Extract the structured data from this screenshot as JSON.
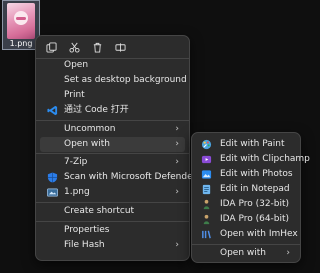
{
  "file": {
    "name": "1.png"
  },
  "quick_actions": [
    "copy-icon",
    "cut-icon",
    "delete-icon",
    "rename-icon"
  ],
  "menu": {
    "open": "Open",
    "set_desktop_bg": "Set as desktop background",
    "print": "Print",
    "open_code": "通过 Code 打开",
    "uncommon": "Uncommon",
    "open_with": "Open with",
    "seven_zip": "7-Zip",
    "scan_defender": "Scan with Microsoft Defender...",
    "file_png": "1.png",
    "create_shortcut": "Create shortcut",
    "properties": "Properties",
    "file_hash": "File Hash"
  },
  "open_with": {
    "paint": "Edit with Paint",
    "clipchamp": "Edit with Clipchamp",
    "photos": "Edit with Photos",
    "notepad": "Edit in Notepad",
    "ida32": "IDA Pro (32-bit)",
    "ida64": "IDA Pro (64-bit)",
    "imhex": "Open with ImHex",
    "open_with": "Open with"
  },
  "colors": {
    "menu_bg": "#2c2c2c",
    "highlight": "#3b3b3b",
    "accent_blue": "#2b8cf0"
  }
}
